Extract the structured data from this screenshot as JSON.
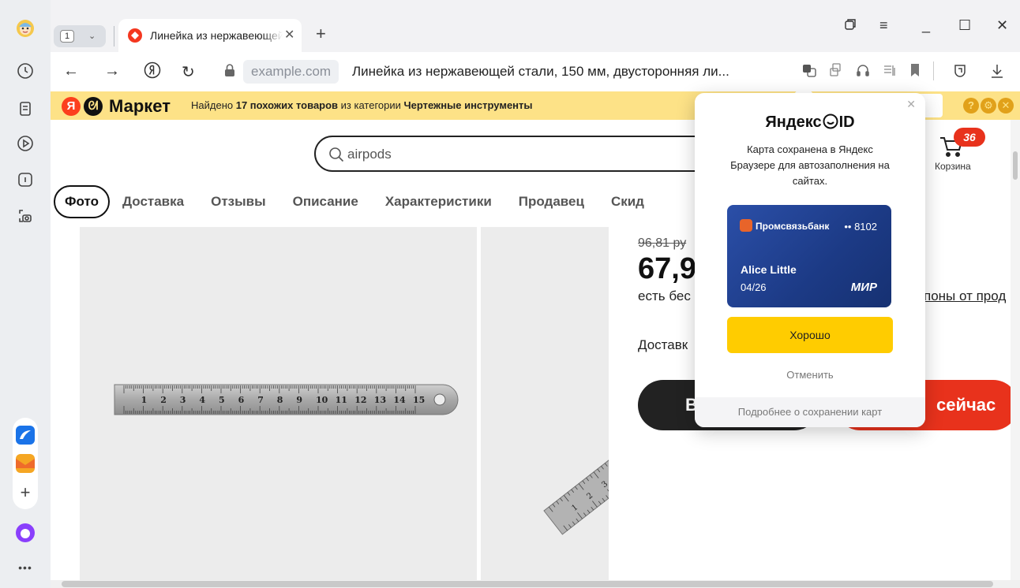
{
  "browser": {
    "tab_count": "1",
    "active_tab_title": "Линейка из нержавеющей стали, 150 мм, двусторонняя линейка",
    "address_domain": "example.com",
    "address_title": "Линейка из нержавеющей стали, 150 мм, двусторонняя ли..."
  },
  "market_bar": {
    "brand": "Маркет",
    "text_prefix": "Найдено ",
    "text_bold_count": "17 похожих товаров",
    "text_middle": " из категории ",
    "text_bold_category": "Чертежные инструменты"
  },
  "page": {
    "search_query": "airpods",
    "cart_count": "36",
    "cart_label": "Корзина",
    "tabs": [
      "Фото",
      "Доставка",
      "Отзывы",
      "Описание",
      "Характеристики",
      "Продавец",
      "Скид"
    ],
    "old_price": "96,81 ру",
    "price": "67,9",
    "free_text": "есть бес",
    "coupons_text": "поны от прод",
    "delivery_text": "Доставк",
    "buy_label": "В",
    "buy_now_label": "сейчас",
    "ruler_marks": [
      "1",
      "2",
      "3",
      "4",
      "5",
      "6",
      "7",
      "8",
      "9",
      "10",
      "11",
      "12",
      "13",
      "14",
      "15"
    ]
  },
  "popup": {
    "logo_text": "Яндекс",
    "logo_id": "ID",
    "message": "Карта сохранена в Яндекс Браузере для автозаполнения на сайтах.",
    "card_bank": "Промсвязьбанк",
    "card_number": "•• 8102",
    "card_holder": "Alice Little",
    "card_expiry": "04/26",
    "card_system": "МИР",
    "ok_label": "Хорошо",
    "cancel_label": "Отменить",
    "footer_link": "Подробнее о сохранении карт"
  },
  "colors": {
    "market_yellow": "#fde287",
    "accent_red": "#e8321c",
    "ok_yellow": "#ffcc00",
    "card_blue": "#1c3a85"
  }
}
